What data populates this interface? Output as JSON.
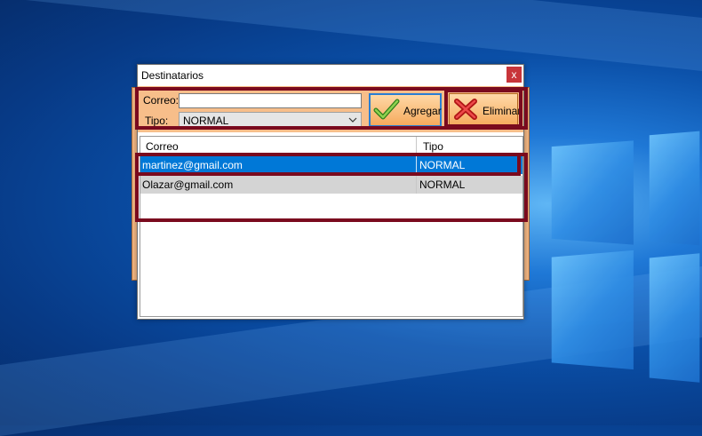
{
  "window": {
    "title": "Destinatarios",
    "close_glyph": "x"
  },
  "form": {
    "correo_label": "Correo:",
    "correo_value": "",
    "tipo_label": "Tipo:",
    "tipo_value": "NORMAL"
  },
  "buttons": {
    "agregar": "Agregar",
    "eliminar": "Eliminar"
  },
  "grid": {
    "columns": [
      "Correo",
      "Tipo"
    ],
    "rows": [
      {
        "correo": "martinez@gmail.com",
        "tipo": "NORMAL",
        "selected": true
      },
      {
        "correo": "Olazar@gmail.com",
        "tipo": "NORMAL",
        "selected": false
      }
    ]
  },
  "colors": {
    "panel": "#f7be8a",
    "selection": "#0078d7",
    "highlight": "#7a0a1e",
    "close": "#c8353a"
  },
  "icons": [
    "check-icon",
    "x-icon",
    "close-icon",
    "chevron-down-icon"
  ]
}
